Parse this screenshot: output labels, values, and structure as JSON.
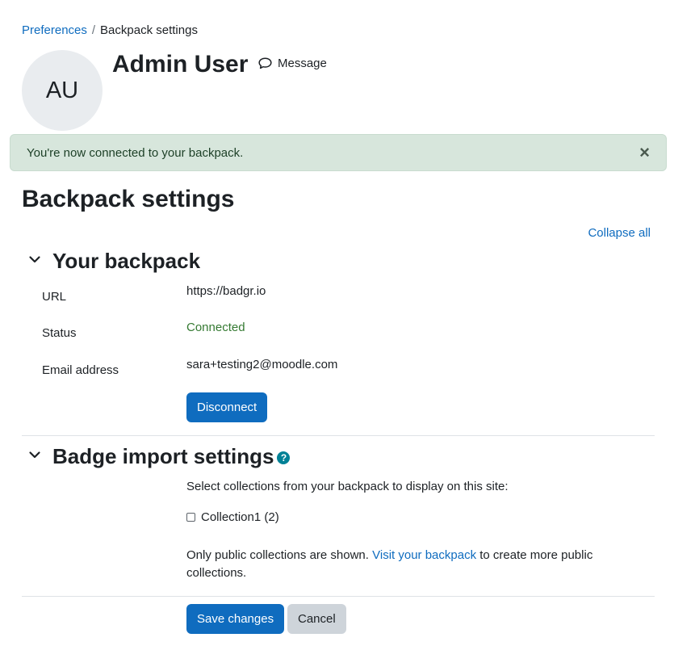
{
  "breadcrumb": {
    "items": [
      "Preferences",
      "Backpack settings"
    ],
    "separator": "/"
  },
  "user": {
    "initials": "AU",
    "name": "Admin User",
    "message_label": "Message"
  },
  "alert": {
    "text": "You're now connected to your backpack.",
    "close_glyph": "×"
  },
  "page": {
    "title": "Backpack settings",
    "collapse_all": "Collapse all"
  },
  "your_backpack": {
    "title": "Your backpack",
    "fields": [
      {
        "label": "URL",
        "value": "https://badgr.io"
      },
      {
        "label": "Status",
        "value": "Connected"
      },
      {
        "label": "Email address",
        "value": "sara+testing2@moodle.com"
      }
    ],
    "disconnect_label": "Disconnect"
  },
  "badge_import": {
    "title": "Badge import settings",
    "help_glyph": "?",
    "instructions": "Select collections from your backpack to display on this site:",
    "collections": [
      {
        "label": "Collection1 (2)",
        "checked": false
      }
    ],
    "note_prefix": "Only public collections are shown. ",
    "note_link": "Visit your backpack",
    "note_suffix": " to create more public collections."
  },
  "form": {
    "save_label": "Save changes",
    "cancel_label": "Cancel"
  },
  "colors": {
    "link": "#0f6cbf",
    "primary_button": "#0f6cbf",
    "alert_background": "#d7e6dc",
    "status_connected": "#357a32",
    "help_icon": "#008196"
  },
  "icons": {
    "message": "chat-bubble-icon",
    "section_toggle": "chevron-down-icon",
    "help": "question-circle-icon",
    "close": "close-icon"
  }
}
